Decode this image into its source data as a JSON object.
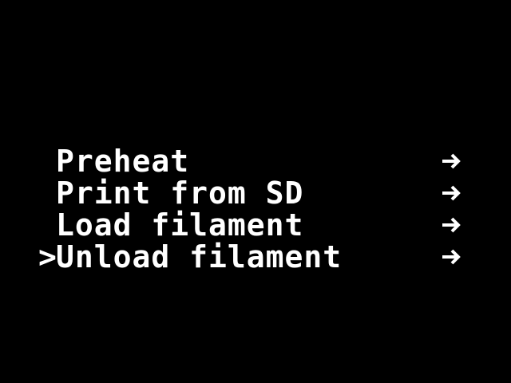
{
  "menu": {
    "items": [
      {
        "cursor": "",
        "label": "Preheat",
        "arrow_icon": "right-arrow-icon"
      },
      {
        "cursor": "",
        "label": "Print from SD",
        "arrow_icon": "right-arrow-icon"
      },
      {
        "cursor": "",
        "label": "Load filament",
        "arrow_icon": "right-arrow-icon"
      },
      {
        "cursor": ">",
        "label": "Unload filament",
        "arrow_icon": "right-arrow-icon"
      }
    ],
    "selected_index": 3
  },
  "colors": {
    "background": "#000000",
    "foreground": "#ffffff"
  }
}
